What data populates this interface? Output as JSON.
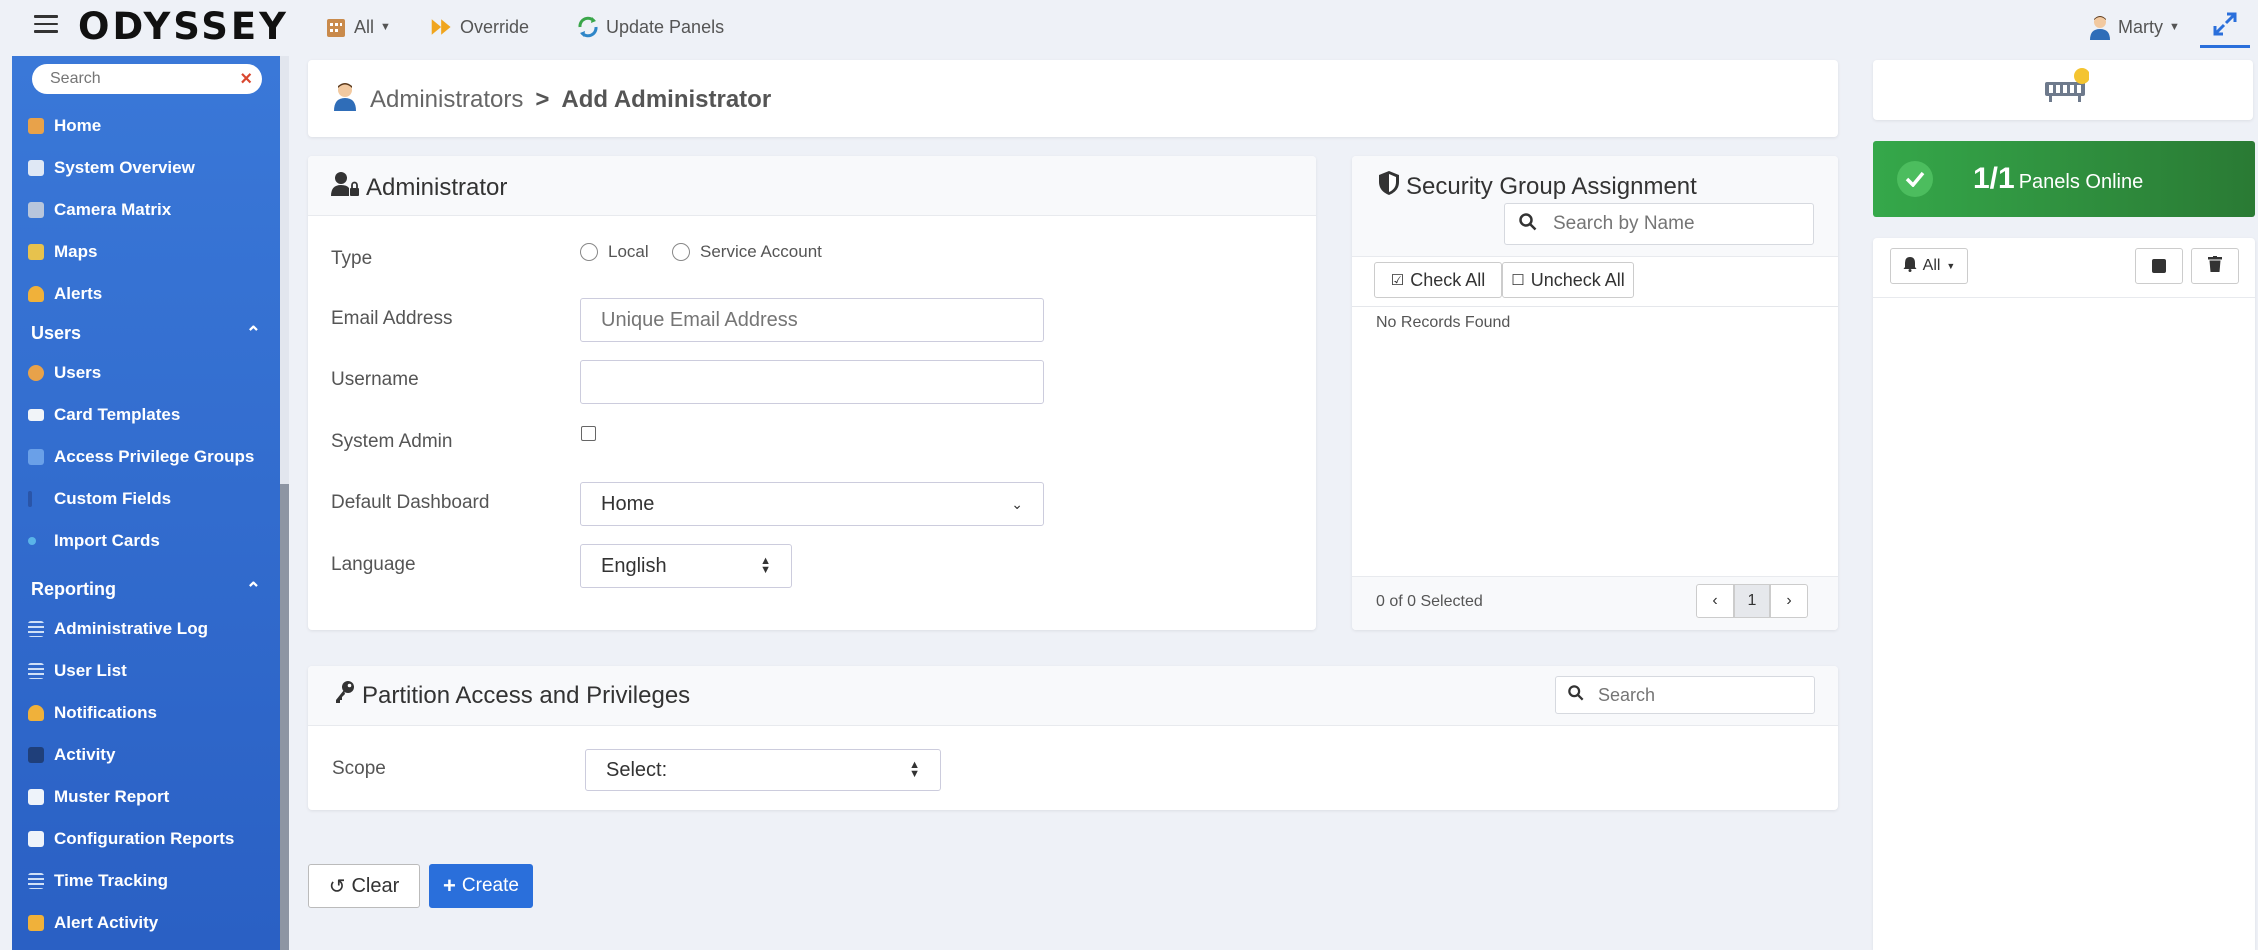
{
  "app": {
    "logo": "ODYSSEY"
  },
  "topbar": {
    "all_label": "All",
    "override_label": "Override",
    "update_panels_label": "Update Panels",
    "user_name": "Marty"
  },
  "sidebar": {
    "search_placeholder": "Search",
    "items_top": [
      {
        "label": "Home"
      },
      {
        "label": "System Overview"
      },
      {
        "label": "Camera Matrix"
      },
      {
        "label": "Maps"
      },
      {
        "label": "Alerts"
      }
    ],
    "users_section": "Users",
    "users_items": [
      {
        "label": "Users"
      },
      {
        "label": "Card Templates"
      },
      {
        "label": "Access Privilege Groups"
      },
      {
        "label": "Custom Fields"
      },
      {
        "label": "Import Cards"
      }
    ],
    "reporting_section": "Reporting",
    "reporting_items": [
      {
        "label": "Administrative Log"
      },
      {
        "label": "User List"
      },
      {
        "label": "Notifications"
      },
      {
        "label": "Activity"
      },
      {
        "label": "Muster Report"
      },
      {
        "label": "Configuration Reports"
      },
      {
        "label": "Time Tracking"
      },
      {
        "label": "Alert Activity"
      }
    ]
  },
  "breadcrumb": {
    "parent": "Administrators",
    "separator": ">",
    "current": "Add Administrator"
  },
  "admin_card": {
    "title": "Administrator",
    "type_label": "Type",
    "type_options": [
      "Local",
      "Service Account"
    ],
    "email_label": "Email Address",
    "email_placeholder": "Unique Email Address",
    "username_label": "Username",
    "username_value": "",
    "sysadmin_label": "System Admin",
    "dashboard_label": "Default Dashboard",
    "dashboard_value": "Home",
    "language_label": "Language",
    "language_value": "English"
  },
  "security_card": {
    "title": "Security Group Assignment",
    "search_placeholder": "Search by Name",
    "check_all": "Check All",
    "uncheck_all": "Uncheck All",
    "empty_text": "No Records Found",
    "selected_text": "0 of 0 Selected",
    "page": "1"
  },
  "partition_card": {
    "title": "Partition Access and Privileges",
    "search_placeholder": "Search",
    "scope_label": "Scope",
    "scope_value": "Select:"
  },
  "actions": {
    "clear": "Clear",
    "create": "Create"
  },
  "right_panel": {
    "panels_count": "1/1",
    "panels_text": "Panels Online",
    "filter_label": "All"
  },
  "colors": {
    "accent": "#2a6fdb",
    "panel_green": "#2e8b3a",
    "sidebar": "#2f68cc"
  }
}
